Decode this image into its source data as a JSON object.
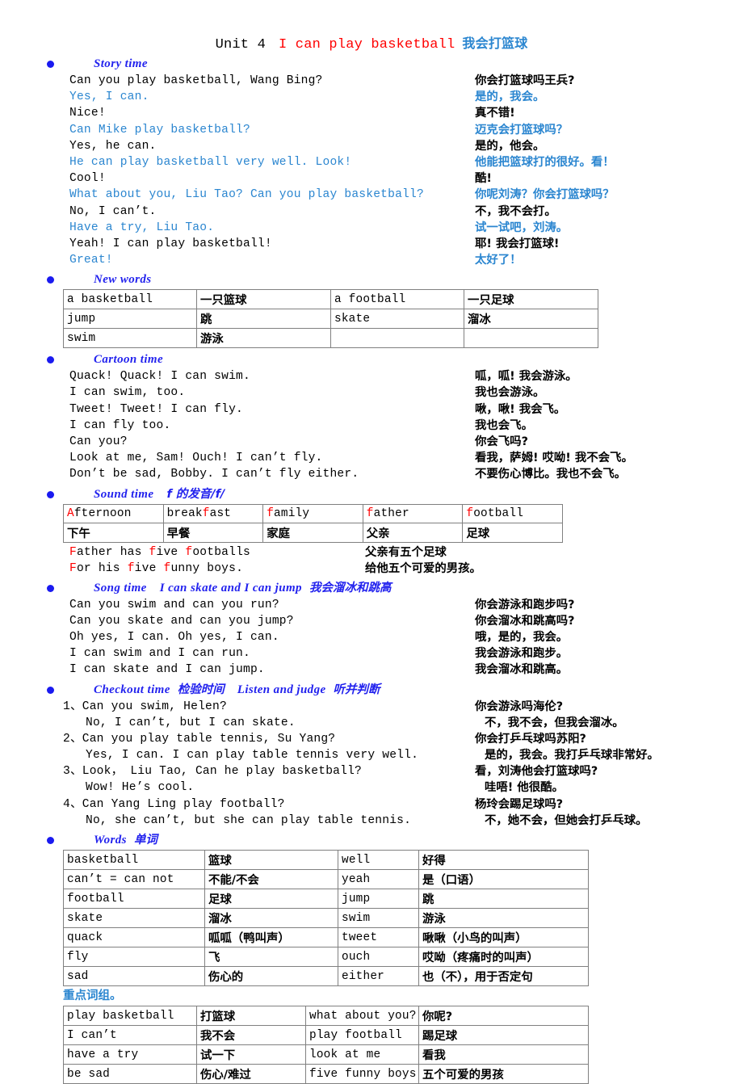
{
  "title": {
    "unit": "Unit 4",
    "english": "I can play basketball",
    "chinese": "我会打篮球"
  },
  "sections": {
    "story": {
      "label_en": "Story time"
    },
    "newwords": {
      "label_en": "New words"
    },
    "cartoon": {
      "label_en": "Cartoon time"
    },
    "sound": {
      "label_en": "Sound time",
      "label_cn": "f 的发音/f/"
    },
    "song": {
      "label_en": "Song time",
      "label_en2": "I can skate and I can jump",
      "label_cn": "我会溜冰和跳高"
    },
    "checkout": {
      "label_en": "Checkout time",
      "label_cn": "检验时间",
      "label_en2": "Listen and judge",
      "label_cn2": "听并判断"
    },
    "words": {
      "label_en": "Words",
      "label_cn": "单词"
    },
    "phrases": {
      "label_cn": "重点词组。"
    }
  },
  "story_lines": [
    {
      "en": "Can you play basketball, Wang Bing?",
      "cn": "你会打篮球吗王兵?",
      "color": "black"
    },
    {
      "en": "Yes, I can.",
      "cn": "是的，我会。",
      "color": "blue"
    },
    {
      "en": "Nice!",
      "cn": "真不错!",
      "color": "black"
    },
    {
      "en": "Can Mike play basketball?",
      "cn": "迈克会打篮球吗？",
      "color": "blue"
    },
    {
      "en": "Yes, he can.",
      "cn": "是的，他会。",
      "color": "black"
    },
    {
      "en": "He can play basketball very well. Look!",
      "cn": "他能把篮球打的很好。看！",
      "color": "blue"
    },
    {
      "en": "Cool!",
      "cn": "酷!",
      "color": "black"
    },
    {
      "en": "What about you, Liu Tao? Can you play basketball?",
      "cn": "你呢刘涛？你会打篮球吗？",
      "color": "blue"
    },
    {
      "en": "No, I can’t.",
      "cn": "不，我不会打。",
      "color": "black"
    },
    {
      "en": "Have a try, Liu Tao.",
      "cn": "试一试吧，刘涛。",
      "color": "blue"
    },
    {
      "en": "Yeah! I can play basketball!",
      "cn": "耶! 我会打篮球!",
      "color": "black"
    },
    {
      "en": "Great!",
      "cn": "太好了！",
      "color": "blue"
    }
  ],
  "newwords_rows": [
    [
      "a basketball",
      "一只篮球",
      "a football",
      "一只足球"
    ],
    [
      "jump",
      "跳",
      "skate",
      "溜冰"
    ],
    [
      "swim",
      "游泳",
      "",
      ""
    ]
  ],
  "cartoon_lines": [
    {
      "en": "Quack! Quack! I can swim.",
      "cn": "呱，呱! 我会游泳。"
    },
    {
      "en": "I can swim, too.",
      "cn": "我也会游泳。"
    },
    {
      "en": "Tweet! Tweet! I can fly.",
      "cn": "啾，啾! 我会飞。"
    },
    {
      "en": "I can fly too.",
      "cn": "我也会飞。"
    },
    {
      "en": "Can you?",
      "cn": "你会飞吗?"
    },
    {
      "en": "Look at me, Sam!  Ouch! I can’t fly.",
      "cn": "看我，萨姆! 哎呦! 我不会飞。"
    },
    {
      "en": "Don’t be sad, Bobby. I can’t fly either.",
      "cn": "不要伤心博比。我也不会飞。"
    }
  ],
  "sound_rows": [
    [
      {
        "lead": "A",
        "rest": "fternoon"
      },
      {
        "lead": "break",
        "mid": "f",
        "rest": "ast"
      },
      {
        "lead": "f",
        "rest": "amily"
      },
      {
        "lead": "f",
        "rest": "ather"
      },
      {
        "lead": "f",
        "rest": "ootball"
      }
    ],
    [
      "下午",
      "早餐",
      "家庭",
      "父亲",
      "足球"
    ]
  ],
  "sound_rhyme": [
    {
      "en": "Father has five footballs",
      "cn": "父亲有五个足球"
    },
    {
      "en": "For his five funny boys.",
      "cn": "给他五个可爱的男孩。"
    }
  ],
  "song_lines": [
    {
      "en": "Can you swim and can you run?",
      "cn": "你会游泳和跑步吗?"
    },
    {
      "en": "Can you skate and can you jump?",
      "cn": "你会溜冰和跳高吗?"
    },
    {
      "en": "Oh yes, I can. Oh yes, I can.",
      "cn": "哦，是的，我会。"
    },
    {
      "en": "I can swim and I can run.",
      "cn": "我会游泳和跑步。"
    },
    {
      "en": "I can skate and I can jump.",
      "cn": "我会溜冰和跳高。"
    }
  ],
  "checkout_items": [
    {
      "q": "1、Can you swim, Helen?",
      "qcn": "你会游泳吗海伦?",
      "a": "No, I can’t, but I can skate.",
      "acn": "不，我不会，但我会溜冰。"
    },
    {
      "q": "2、Can you play table tennis, Su Yang?",
      "qcn": "你会打乒乓球吗苏阳?",
      "a": "Yes, I can. I can play table tennis very well.",
      "acn": "是的，我会。我打乒乓球非常好。"
    },
    {
      "q": "3、Look，  Liu Tao, Can he play basketball?",
      "qcn": "看，刘涛他会打篮球吗?",
      "a": "Wow! He’s cool.",
      "acn": "哇唔! 他很酷。"
    },
    {
      "q": "4、Can Yang Ling play football?",
      "qcn": "杨玲会踢足球吗?",
      "a": "No, she can’t, but she can play table tennis.",
      "acn": "不，她不会，但她会打乒乓球。"
    }
  ],
  "words_rows": [
    [
      "basketball",
      "篮球",
      "well",
      "好得"
    ],
    [
      "can’t = can not",
      "不能/不会",
      "yeah",
      "是（口语）"
    ],
    [
      "football",
      "足球",
      "jump",
      "跳"
    ],
    [
      "skate",
      "溜冰",
      "swim",
      "游泳"
    ],
    [
      "quack",
      "呱呱（鸭叫声）",
      "tweet",
      "啾啾（小鸟的叫声）"
    ],
    [
      "fly",
      "飞",
      "ouch",
      "哎呦（疼痛时的叫声）"
    ],
    [
      "sad",
      "伤心的",
      "either",
      "也（不），用于否定句"
    ]
  ],
  "phrases_rows": [
    [
      "play basketball",
      "打篮球",
      "what about you?",
      "你呢?"
    ],
    [
      "I can’t",
      "我不会",
      "play football",
      "踢足球"
    ],
    [
      "have a try",
      "试一下",
      "look at me",
      "看我"
    ],
    [
      "be sad",
      "伤心/难过",
      "five funny boys",
      "五个可爱的男孩"
    ]
  ],
  "colors": {
    "blue_text": "#2b86d0",
    "header_blue": "#2222ee",
    "red": "#ff0000",
    "black": "#000000"
  }
}
